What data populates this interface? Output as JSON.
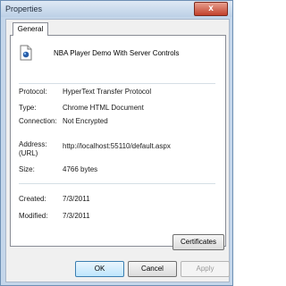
{
  "window": {
    "title": "Properties",
    "close_glyph": "x"
  },
  "tabs": [
    {
      "label": "General"
    }
  ],
  "general": {
    "file_name": "NBA Player Demo With Server Controls",
    "protocol_label": "Protocol:",
    "protocol_value": "HyperText Transfer Protocol",
    "type_label": "Type:",
    "type_value": "Chrome HTML Document",
    "connection_label": "Connection:",
    "connection_value": "Not Encrypted",
    "address_label": "Address:\n(URL)",
    "address_value": "http://localhost:55110/default.aspx",
    "size_label": "Size:",
    "size_value": "4766 bytes",
    "created_label": "Created:",
    "created_value": "7/3/2011",
    "modified_label": "Modified:",
    "modified_value": "7/3/2011",
    "certificates_label": "Certificates"
  },
  "buttons": {
    "ok": "OK",
    "cancel": "Cancel",
    "apply": "Apply"
  },
  "icons": {
    "file": "html-document-icon",
    "close": "close-icon"
  }
}
